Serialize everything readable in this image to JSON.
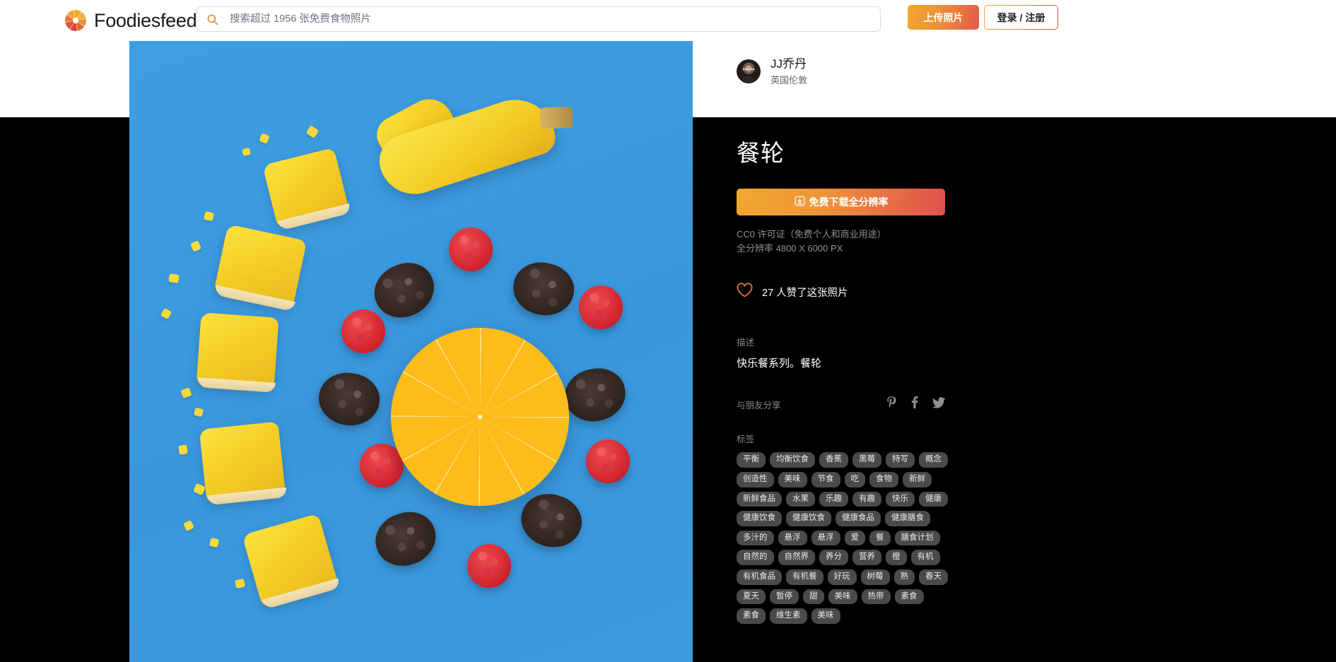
{
  "header": {
    "brand_name": "Foodiesfeed",
    "logo_icon": "aperture-logo-icon",
    "search": {
      "icon": "search-icon",
      "placeholder": "搜索超过 1956 张免费食物照片",
      "value": ""
    },
    "upload_label": "上传照片",
    "login_label": "登录 / 注册",
    "accent_start": "#f0a830",
    "accent_end": "#e0504a"
  },
  "author": {
    "avatar_icon": "avatar",
    "name": "JJ乔丹",
    "location": "英国伦敦"
  },
  "photo": {
    "title": "餐轮",
    "alt": "orange-slice-banana-berries-wheel"
  },
  "download": {
    "icon": "download-icon",
    "label": "免费下载全分辨率"
  },
  "license": {
    "line1": "CC0 许可证（免费个人和商业用途）",
    "line2": "全分辨率 4800 X 6000 PX"
  },
  "likes": {
    "icon": "heart-icon",
    "icon_color": "#d9783a",
    "text": "27 人赞了这张照片"
  },
  "description": {
    "label": "描述",
    "text": "快乐餐系列。餐轮"
  },
  "share": {
    "label": "与朋友分享",
    "icons": [
      "pinterest-icon",
      "facebook-icon",
      "twitter-icon"
    ]
  },
  "tags": {
    "label": "标签",
    "items": [
      "平衡",
      "均衡饮食",
      "香蕉",
      "黑莓",
      "特写",
      "概念",
      "创造性",
      "美味",
      "节食",
      "吃",
      "食物",
      "新鲜",
      "新鲜食品",
      "水果",
      "乐趣",
      "有趣",
      "快乐",
      "健康",
      "健康饮食",
      "健康饮食",
      "健康食品",
      "健康膳食",
      "多汁的",
      "悬浮",
      "悬浮",
      "爱",
      "餐",
      "膳食计划",
      "自然的",
      "自然界",
      "养分",
      "营养",
      "橙",
      "有机",
      "有机食品",
      "有机餐",
      "好玩",
      "树莓",
      "熟",
      "春天",
      "夏天",
      "暂停",
      "甜",
      "美味",
      "热带",
      "素食",
      "素食",
      "维生素",
      "美味"
    ]
  }
}
